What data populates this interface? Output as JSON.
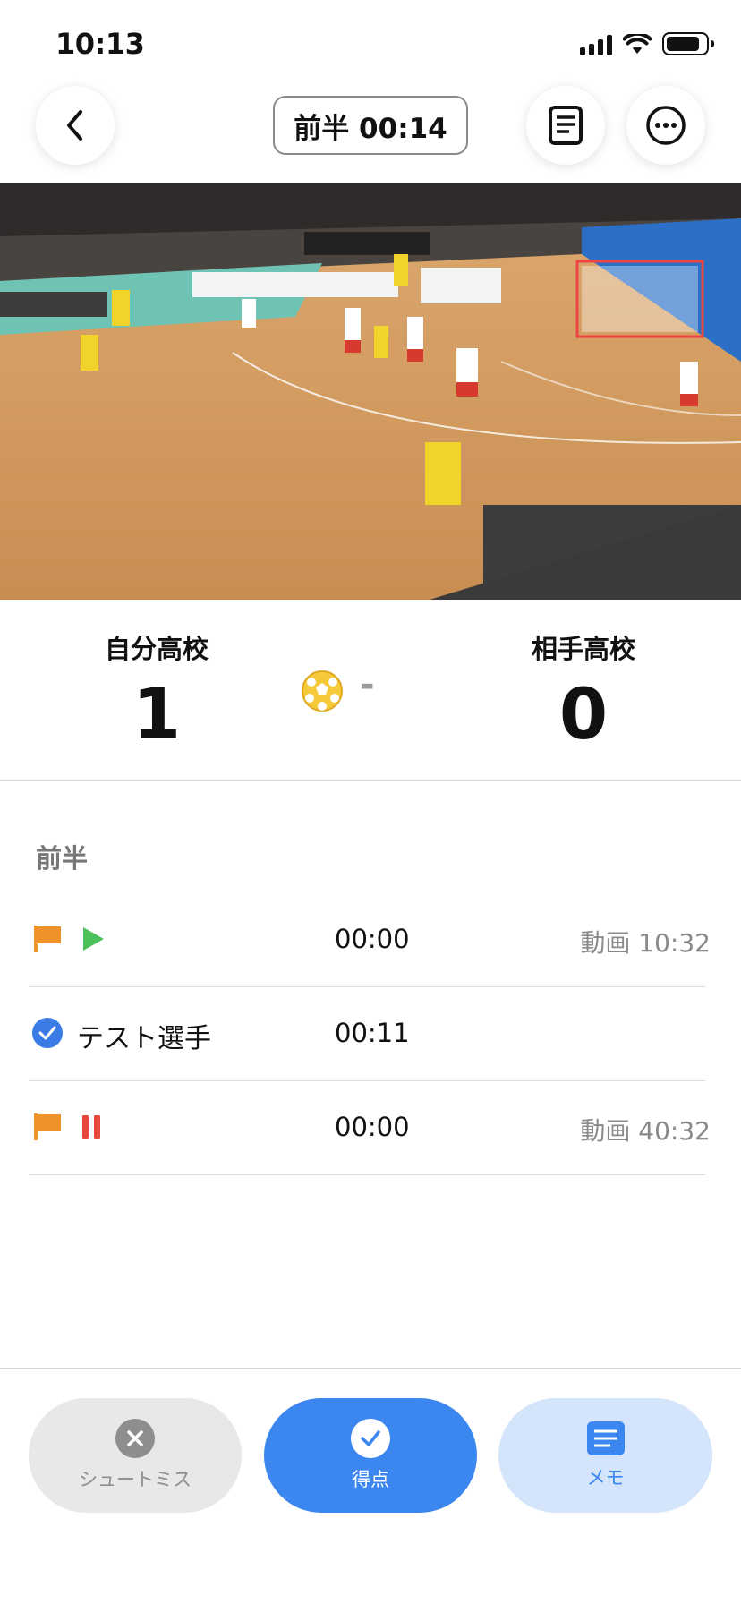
{
  "status_bar": {
    "time": "10:13"
  },
  "header": {
    "timer_label": "前半 00:14"
  },
  "scoreboard": {
    "home": {
      "name": "自分高校",
      "score": "1"
    },
    "away": {
      "name": "相手高校",
      "score": "0"
    },
    "separator": "-"
  },
  "events": {
    "section_label": "前半",
    "rows": [
      {
        "type": "start",
        "time": "00:00",
        "video_time": "動画 10:32"
      },
      {
        "type": "goal",
        "player": "テスト選手",
        "time": "00:11"
      },
      {
        "type": "pause",
        "time": "00:00",
        "video_time": "動画 40:32"
      }
    ]
  },
  "actions": {
    "miss_label": "シュートミス",
    "score_label": "得点",
    "memo_label": "メモ"
  },
  "colors": {
    "accent_blue": "#3b86ef",
    "flag_orange": "#f0922b",
    "play_green": "#4cc05a",
    "pause_red": "#e8453c",
    "ball_yellow": "#f6c93b"
  }
}
